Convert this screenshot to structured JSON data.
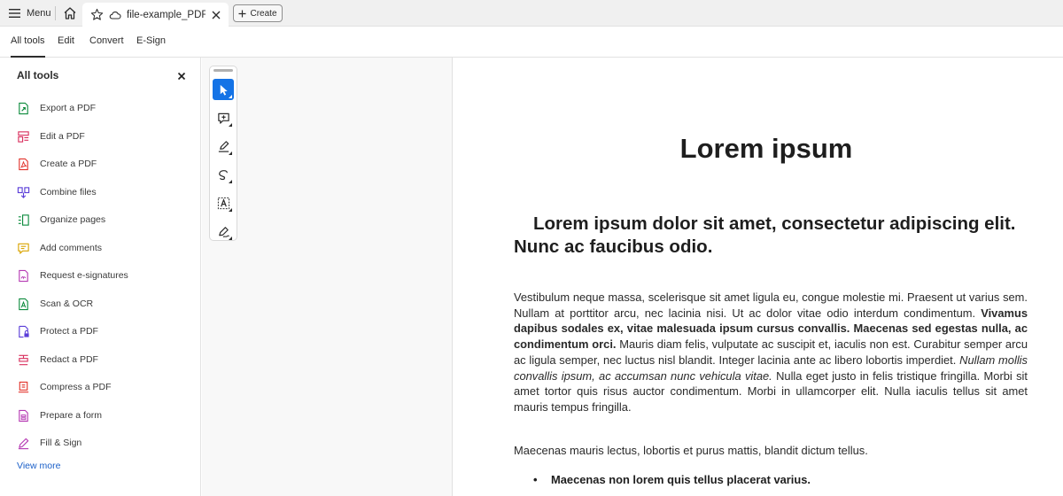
{
  "titlebar": {
    "menu_label": "Menu",
    "home_icon": "home-icon",
    "tab": {
      "name": "file-example_PDF_...",
      "star_icon": "star-icon",
      "cloud_icon": "cloud-icon",
      "close_icon": "close-icon"
    },
    "create_label": "Create"
  },
  "toptabs": [
    {
      "label": "All tools",
      "active": true
    },
    {
      "label": "Edit"
    },
    {
      "label": "Convert"
    },
    {
      "label": "E-Sign"
    }
  ],
  "leftpanel": {
    "title": "All tools",
    "tools": [
      {
        "label": "Export a PDF",
        "icon": "export-pdf-icon",
        "color": "#0d8b3d"
      },
      {
        "label": "Edit a PDF",
        "icon": "edit-pdf-icon",
        "color": "#d9305f"
      },
      {
        "label": "Create a PDF",
        "icon": "create-pdf-icon",
        "color": "#e2342c"
      },
      {
        "label": "Combine files",
        "icon": "combine-files-icon",
        "color": "#5a3dd8"
      },
      {
        "label": "Organize pages",
        "icon": "organize-pages-icon",
        "color": "#0d8b3d"
      },
      {
        "label": "Add comments",
        "icon": "add-comments-icon",
        "color": "#d9a400"
      },
      {
        "label": "Request e-signatures",
        "icon": "request-esign-icon",
        "color": "#b53ab3"
      },
      {
        "label": "Scan & OCR",
        "icon": "scan-ocr-icon",
        "color": "#0d8b3d"
      },
      {
        "label": "Protect a PDF",
        "icon": "protect-pdf-icon",
        "color": "#5a3dd8"
      },
      {
        "label": "Redact a PDF",
        "icon": "redact-pdf-icon",
        "color": "#d9305f"
      },
      {
        "label": "Compress a PDF",
        "icon": "compress-pdf-icon",
        "color": "#e2342c"
      },
      {
        "label": "Prepare a form",
        "icon": "prepare-form-icon",
        "color": "#b53ab3"
      },
      {
        "label": "Fill & Sign",
        "icon": "fill-sign-icon",
        "color": "#b53ab3"
      }
    ],
    "view_more": "View more"
  },
  "quicktools": [
    {
      "icon": "select-cursor-icon",
      "active": true
    },
    {
      "icon": "add-comment-icon"
    },
    {
      "icon": "highlight-pen-icon"
    },
    {
      "icon": "draw-freehand-icon"
    },
    {
      "icon": "text-box-icon"
    },
    {
      "icon": "sign-pen-icon"
    }
  ],
  "document": {
    "h1": "Lorem ipsum",
    "h2": "Lorem ipsum dolor sit amet, consectetur adipiscing elit. Nunc ac faucibus odio.",
    "p1": {
      "a": "Vestibulum neque massa, scelerisque sit amet ligula eu, congue molestie mi. Praesent ut varius sem. Nullam at porttitor arcu, nec lacinia nisi. Ut ac dolor vitae odio interdum condimentum. ",
      "b": "Vivamus dapibus sodales ex, vitae malesuada ipsum cursus convallis. Maecenas sed egestas nulla, ac condimentum orci.",
      "c": " Mauris diam felis, vulputate ac suscipit et, iaculis non est. Curabitur semper arcu ac ligula semper, nec luctus nisl blandit. Integer lacinia ante ac libero lobortis imperdiet. ",
      "d": "Nullam mollis convallis ipsum, ac accumsan nunc vehicula vitae.",
      "e": " Nulla eget justo in felis tristique fringilla. Morbi sit amet tortor quis risus auctor condimentum. Morbi in ullamcorper elit. Nulla iaculis tellus sit amet mauris tempus fringilla."
    },
    "p2": "Maecenas mauris lectus, lobortis et purus mattis, blandit dictum tellus.",
    "bullet": "Maecenas non lorem quis tellus placerat varius."
  }
}
